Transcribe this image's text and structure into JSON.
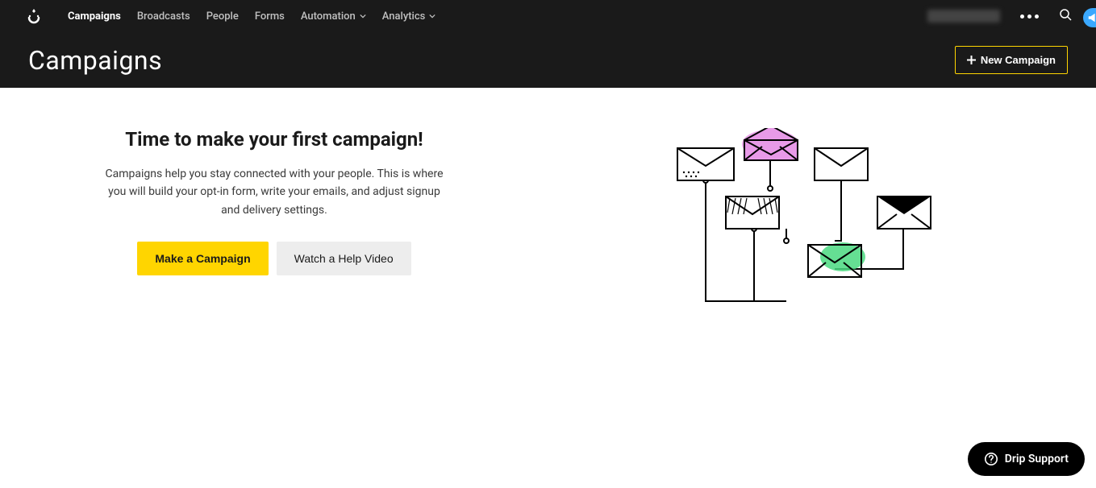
{
  "nav": {
    "items": [
      {
        "label": "Campaigns",
        "active": true,
        "dropdown": false
      },
      {
        "label": "Broadcasts",
        "active": false,
        "dropdown": false
      },
      {
        "label": "People",
        "active": false,
        "dropdown": false
      },
      {
        "label": "Forms",
        "active": false,
        "dropdown": false
      },
      {
        "label": "Automation",
        "active": false,
        "dropdown": true
      },
      {
        "label": "Analytics",
        "active": false,
        "dropdown": true
      }
    ]
  },
  "page": {
    "title": "Campaigns",
    "new_button": "New Campaign"
  },
  "empty_state": {
    "heading": "Time to make your first campaign!",
    "description": "Campaigns help you stay connected with your people. This is where you will build your opt-in form, write your emails, and adjust signup and delivery settings.",
    "primary_cta": "Make a Campaign",
    "secondary_cta": "Watch a Help Video"
  },
  "support": {
    "label": "Drip Support"
  }
}
